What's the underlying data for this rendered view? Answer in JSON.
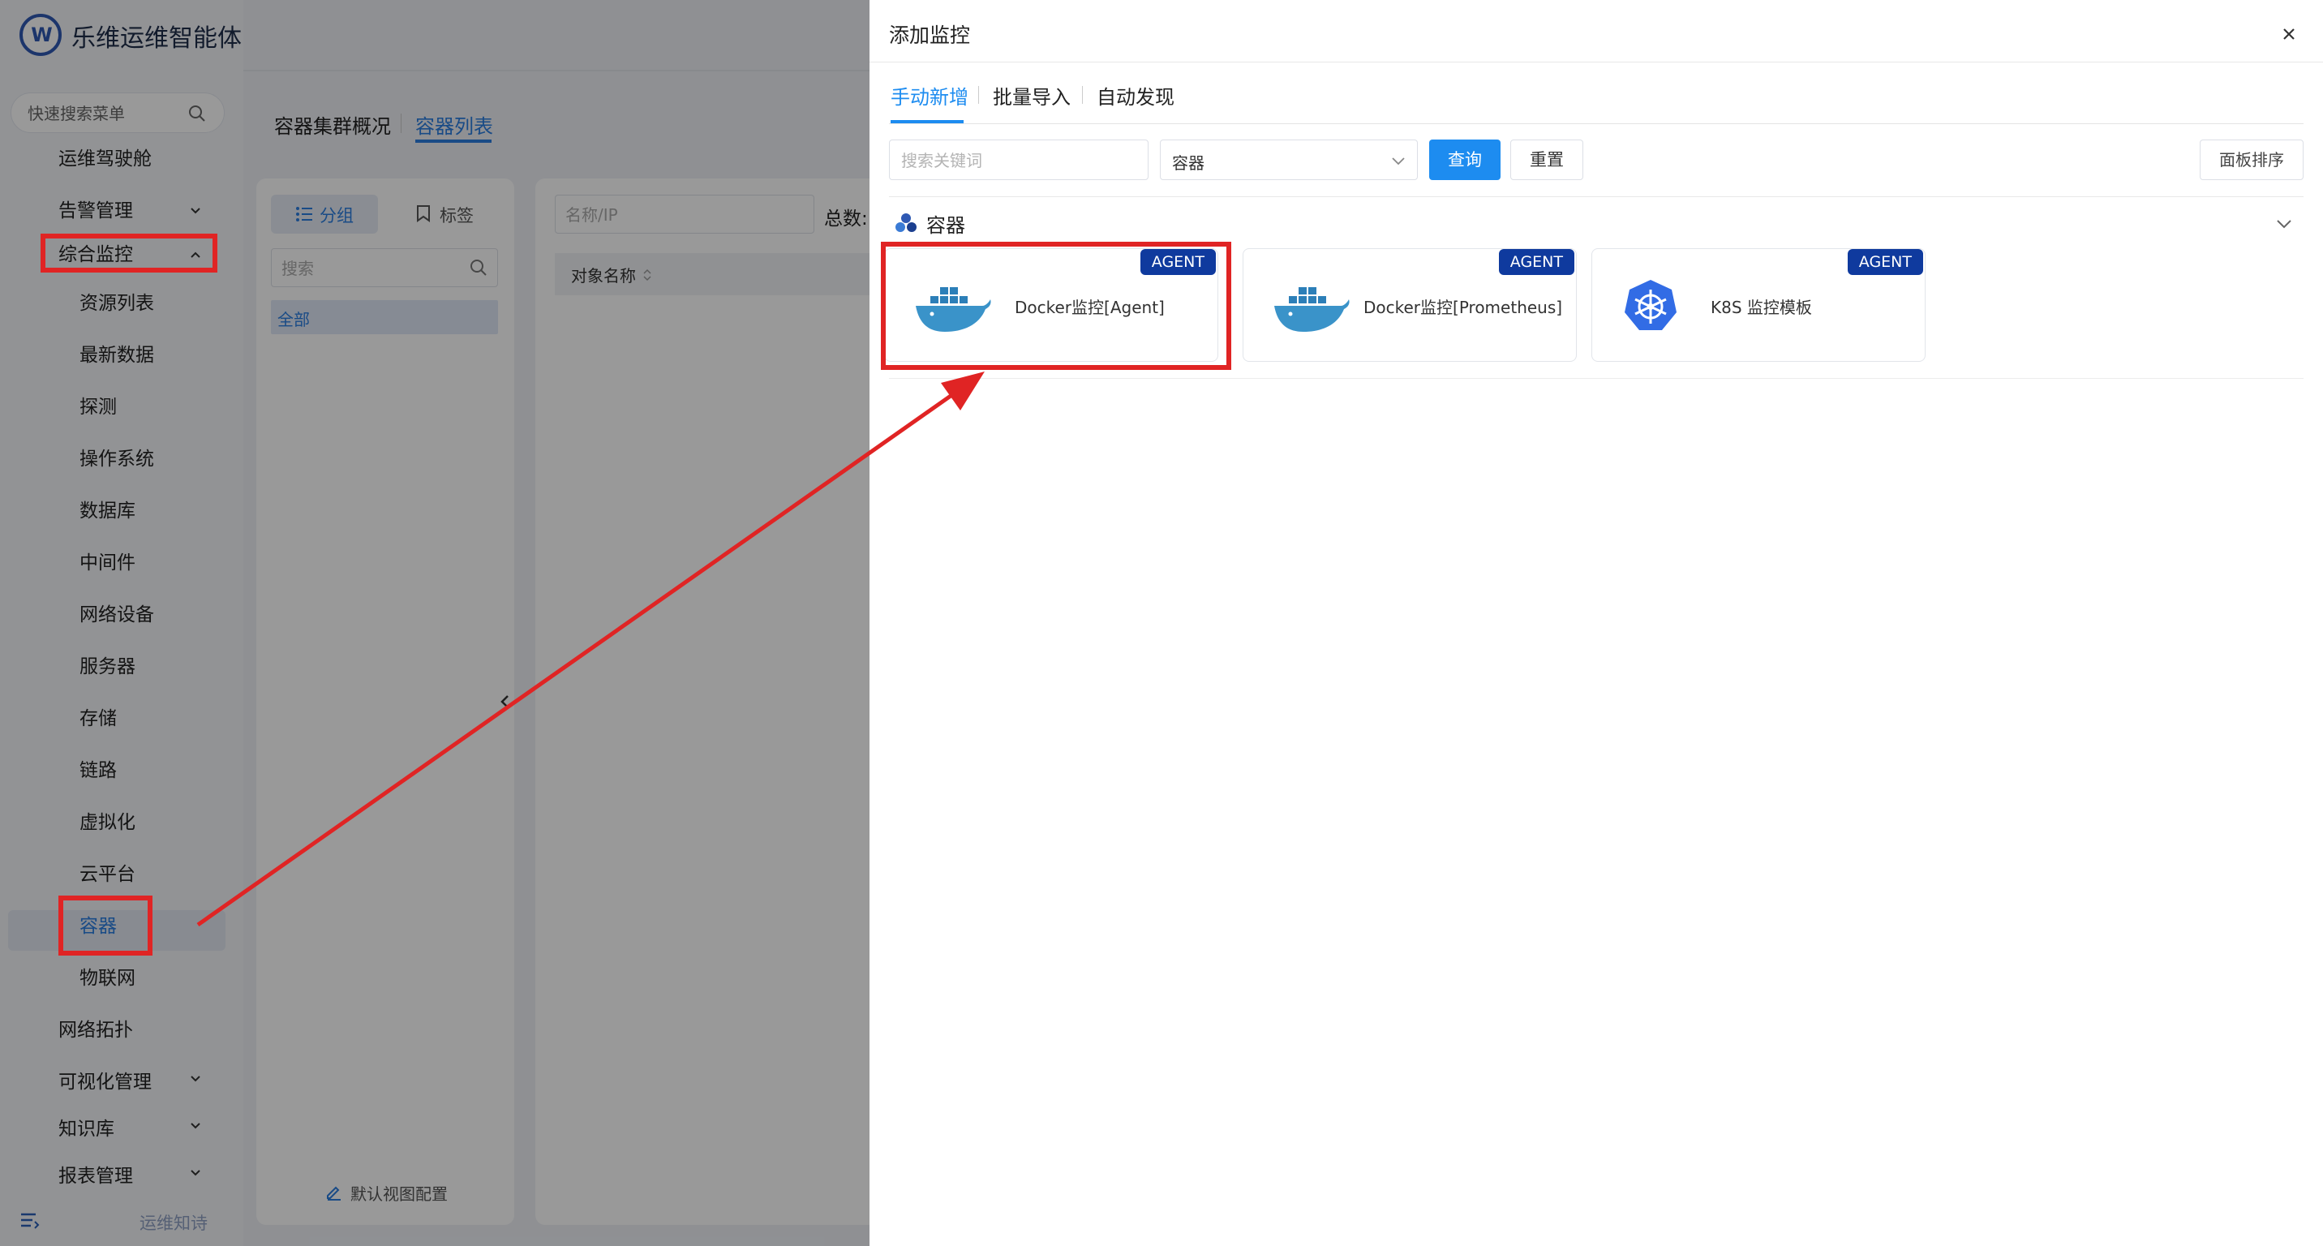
{
  "app": {
    "logo_text": "乐维运维智能体"
  },
  "sidebar": {
    "search_placeholder": "快速搜索菜单",
    "items": [
      {
        "label": "运维驾驶舱"
      },
      {
        "label": "告警管理"
      },
      {
        "label": "综合监控"
      },
      {
        "label": "资源列表"
      },
      {
        "label": "最新数据"
      },
      {
        "label": "探测"
      },
      {
        "label": "操作系统"
      },
      {
        "label": "数据库"
      },
      {
        "label": "中间件"
      },
      {
        "label": "网络设备"
      },
      {
        "label": "服务器"
      },
      {
        "label": "存储"
      },
      {
        "label": "链路"
      },
      {
        "label": "虚拟化"
      },
      {
        "label": "云平台"
      },
      {
        "label": "容器"
      },
      {
        "label": "物联网"
      },
      {
        "label": "网络拓扑"
      },
      {
        "label": "可视化管理"
      },
      {
        "label": "知识库"
      },
      {
        "label": "报表管理"
      }
    ],
    "footer_text": "运维知诗"
  },
  "main": {
    "tabs": [
      {
        "label": "容器集群概况"
      },
      {
        "label": "容器列表"
      }
    ],
    "segments": [
      {
        "label": "分组"
      },
      {
        "label": "标签"
      }
    ],
    "left_search_placeholder": "搜索",
    "all_label": "全部",
    "bottom_config": "默认视图配置",
    "name_ip_placeholder": "名称/IP",
    "total_label": "总数:",
    "column_object_name": "对象名称"
  },
  "drawer": {
    "title": "添加监控",
    "tabs": [
      {
        "label": "手动新增"
      },
      {
        "label": "批量导入"
      },
      {
        "label": "自动发现"
      }
    ],
    "keyword_placeholder": "搜索关键词",
    "type_select_value": "容器",
    "query_label": "查询",
    "reset_label": "重置",
    "sort_label": "面板排序",
    "section_title": "容器",
    "cards": [
      {
        "name": "Docker监控[Agent]",
        "badge": "AGENT",
        "icon": "docker-icon"
      },
      {
        "name": "Docker监控[Prometheus]",
        "badge": "AGENT",
        "icon": "docker-icon"
      },
      {
        "name": "K8S 监控模板",
        "badge": "AGENT",
        "icon": "kubernetes-icon"
      }
    ]
  },
  "colors": {
    "accent": "#1d8cf0",
    "badge": "#0f3a9e",
    "highlight": "#e02424",
    "brand": "#2f59b3"
  }
}
